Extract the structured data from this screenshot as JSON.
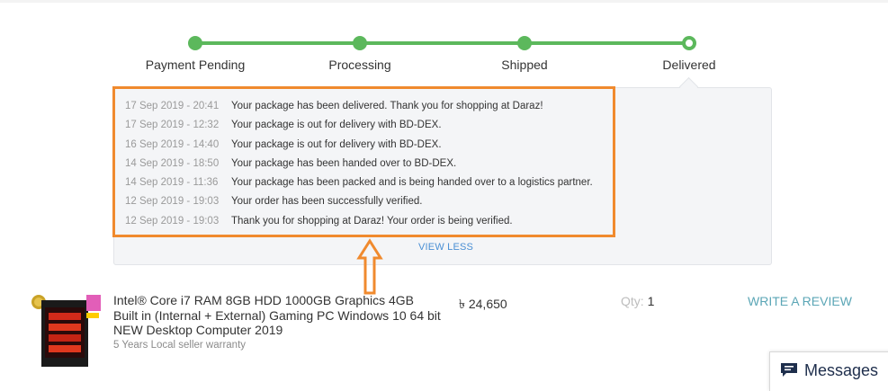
{
  "tracker": {
    "color": "#5cb85c",
    "steps": [
      {
        "label": "Payment Pending"
      },
      {
        "label": "Processing"
      },
      {
        "label": "Shipped"
      },
      {
        "label": "Delivered"
      }
    ]
  },
  "history": {
    "events": [
      {
        "time": "17 Sep 2019 - 20:41",
        "message": "Your package has been delivered. Thank you for shopping at Daraz!"
      },
      {
        "time": "17 Sep 2019 - 12:32",
        "message": "Your package is out for delivery with BD-DEX."
      },
      {
        "time": "16 Sep 2019 - 14:40",
        "message": "Your package is out for delivery with BD-DEX."
      },
      {
        "time": "14 Sep 2019 - 18:50",
        "message": "Your package has been handed over to BD-DEX."
      },
      {
        "time": "14 Sep 2019 - 11:36",
        "message": "Your package has been packed and is being handed over to a logistics partner."
      },
      {
        "time": "12 Sep 2019 - 19:03",
        "message": "Your order has been successfully verified."
      },
      {
        "time": "12 Sep 2019 - 19:03",
        "message": "Thank you for shopping at Daraz! Your order is being verified."
      }
    ],
    "view_less_label": "VIEW LESS",
    "highlight_color": "#f08a2e"
  },
  "product": {
    "title": "Intel® Core i7 RAM 8GB HDD 1000GB Graphics 4GB Built in (Internal + External) Gaming PC Windows 10 64 bit NEW Desktop Computer 2019",
    "warranty": "5 Years Local seller warranty",
    "price": "৳ 24,650",
    "qty_label": "Qty:",
    "qty_value": "1",
    "review_label": "WRITE A REVIEW"
  },
  "messages": {
    "label": "Messages",
    "icon": "chat-bubble-icon"
  }
}
